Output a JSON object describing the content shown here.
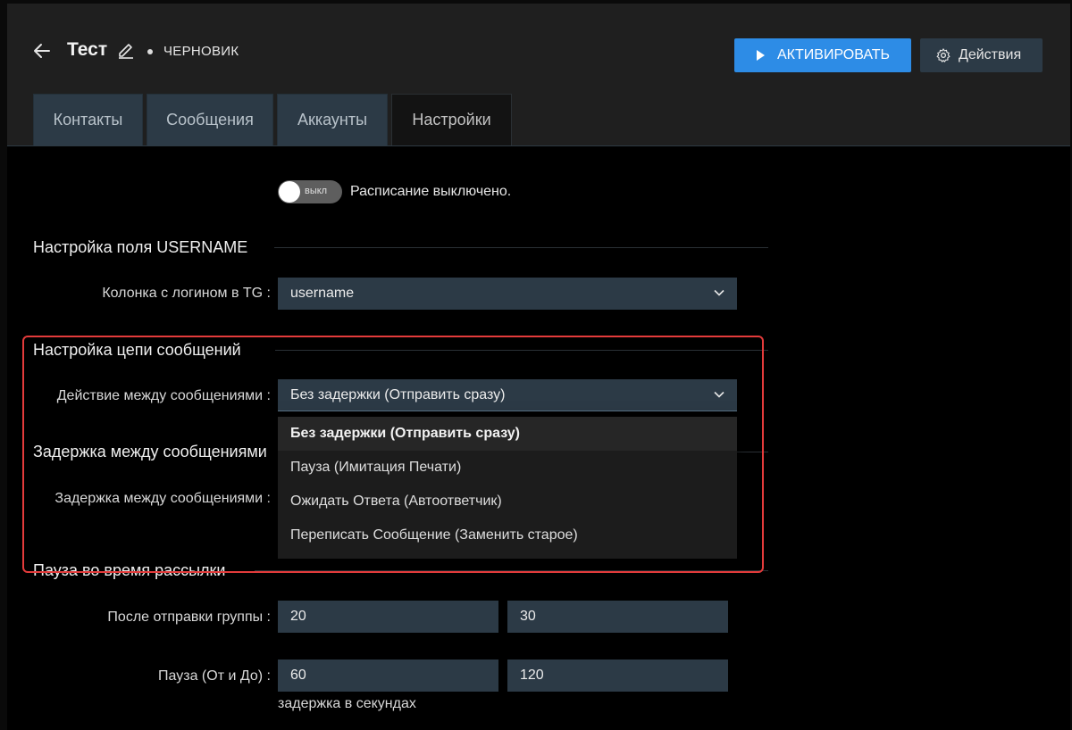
{
  "header": {
    "title": "Тест",
    "status": "ЧЕРНОВИК",
    "activate_label": "АКТИВИРОВАТЬ",
    "actions_label": "Действия"
  },
  "tabs": [
    {
      "label": "Контакты",
      "active": false
    },
    {
      "label": "Сообщения",
      "active": false
    },
    {
      "label": "Аккаунты",
      "active": false
    },
    {
      "label": "Настройки",
      "active": true
    }
  ],
  "schedule": {
    "toggle_label": "выкл",
    "text": "Расписание выключено."
  },
  "username_section": {
    "title": "Настройка поля USERNAME",
    "login_label": "Колонка с логином в TG :",
    "login_value": "username"
  },
  "chain_section": {
    "title": "Настройка цепи сообщений",
    "action_label": "Действие между сообщениями :",
    "action_value": "Без задержки (Отправить сразу)",
    "options": [
      "Без задержки (Отправить сразу)",
      "Пауза (Имитация Печати)",
      "Ожидать Ответа (Автоответчик)",
      "Переписать Сообщение (Заменить старое)"
    ]
  },
  "delay_section": {
    "title": "Задержка между сообщениями",
    "label": "Задержка между сообщениями :"
  },
  "pause_section": {
    "title": "Пауза во время рассылки",
    "group_label": "После отправки группы :",
    "group_from": "20",
    "group_to": "30",
    "pause_label": "Пауза (От и До) :",
    "pause_from": "60",
    "pause_to": "120",
    "hint": "задержка в секундах"
  },
  "colors": {
    "accent": "#2d8ce6",
    "highlight": "#e33b3b",
    "field_bg": "#2c3a46"
  }
}
